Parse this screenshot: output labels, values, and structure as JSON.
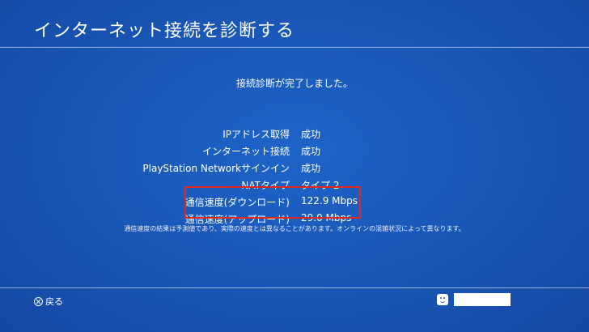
{
  "header": {
    "title": "インターネット接続を診断する"
  },
  "status_message": "接続診断が完了しました。",
  "results": [
    {
      "label": "IPアドレス取得",
      "value": "成功"
    },
    {
      "label": "インターネット接続",
      "value": "成功"
    },
    {
      "label": "PlayStation Networkサインイン",
      "value": "成功"
    },
    {
      "label": "NATタイプ",
      "value": "タイプ 2"
    },
    {
      "label": "通信速度(ダウンロード)",
      "value": "122.9 Mbps"
    },
    {
      "label": "通信速度(アップロード)",
      "value": "29.0 Mbps"
    }
  ],
  "note": "通信速度の結果は予測値であり、実際の速度とは異なることがあります。オンラインの混雑状況によって異なります。",
  "footer": {
    "back_label": "戻る",
    "back_icon": "cross-button-icon",
    "user_icon": "user-avatar-icon"
  },
  "colors": {
    "background": "#1a58b8",
    "highlight": "#e0281e"
  }
}
